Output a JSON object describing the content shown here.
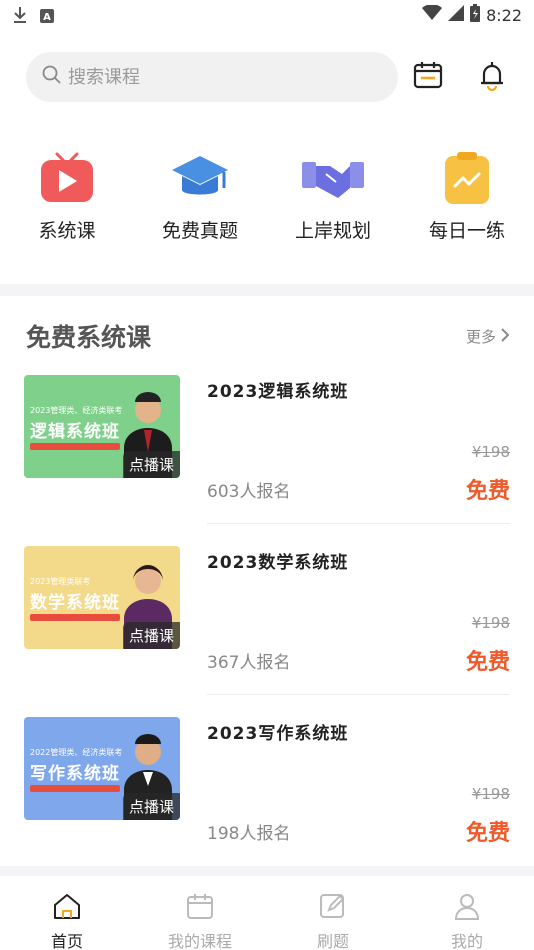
{
  "status": {
    "time": "8:22"
  },
  "search": {
    "placeholder": "搜索课程"
  },
  "categories": [
    {
      "label": "系统课",
      "icon": "tv-play-icon"
    },
    {
      "label": "免费真题",
      "icon": "graduation-cap-icon"
    },
    {
      "label": "上岸规划",
      "icon": "handshake-icon"
    },
    {
      "label": "每日一练",
      "icon": "clipboard-chart-icon"
    }
  ],
  "section": {
    "title": "免费系统课",
    "more": "更多"
  },
  "courses": [
    {
      "name": "2023逻辑系统班",
      "enrolled": "603人报名",
      "original_price": "¥198",
      "price": "免费",
      "badge": "点播课",
      "thumb_title": "逻辑系统班",
      "thumb_top": "2023管理类、经济类联考",
      "thumb_color": "#7fd08a"
    },
    {
      "name": "2023数学系统班",
      "enrolled": "367人报名",
      "original_price": "¥198",
      "price": "免费",
      "badge": "点播课",
      "thumb_title": "数学系统班",
      "thumb_top": "2023管理类联考",
      "thumb_color": "#f3d98a"
    },
    {
      "name": "2023写作系统班",
      "enrolled": "198人报名",
      "original_price": "¥198",
      "price": "免费",
      "badge": "点播课",
      "thumb_title": "写作系统班",
      "thumb_top": "2022管理类、经济类联考",
      "thumb_color": "#7ea7ec"
    }
  ],
  "tabs": [
    {
      "label": "首页"
    },
    {
      "label": "我的课程"
    },
    {
      "label": "刷题"
    },
    {
      "label": "我的"
    }
  ],
  "colors": {
    "price": "#f05a2a",
    "accent_orange": "#f5a623"
  }
}
